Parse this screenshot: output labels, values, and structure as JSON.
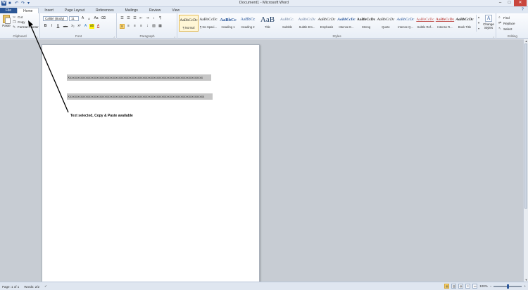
{
  "window": {
    "title": "Document1 - Microsoft Word",
    "app_letter": "W",
    "minimize": "–",
    "maximize": "□",
    "close": "✕"
  },
  "qat": {
    "save": "■",
    "undo": "↶",
    "redo": "↷",
    "more": "▾"
  },
  "tabs": [
    {
      "label": "File"
    },
    {
      "label": "Home"
    },
    {
      "label": "Insert"
    },
    {
      "label": "Page Layout"
    },
    {
      "label": "References"
    },
    {
      "label": "Mailings"
    },
    {
      "label": "Review"
    },
    {
      "label": "View"
    }
  ],
  "help": "?",
  "clipboard": {
    "label": "Clipboard",
    "paste": "Paste",
    "cut": "Cut",
    "copy": "Copy",
    "format_painter": "Format Painter"
  },
  "font": {
    "label": "Font",
    "name": "Calibri (Body)",
    "size": "11",
    "grow": "A",
    "shrink": "A",
    "case": "Aa",
    "clear": "⌫",
    "bold": "B",
    "italic": "I",
    "underline": "U",
    "strike": "abc",
    "subscript": "x₂",
    "superscript": "x²",
    "effects": "A",
    "highlight": "ab",
    "color": "A"
  },
  "paragraph": {
    "label": "Paragraph",
    "bullets": "☰",
    "numbering": "☰",
    "multilevel": "☰",
    "decrease": "⇤",
    "increase": "⇥",
    "sort": "↕",
    "pilcrow": "¶",
    "left": "≡",
    "center": "≡",
    "right": "≡",
    "justify": "≡",
    "spacing": "↕",
    "shading": "▨",
    "borders": "▦"
  },
  "styles": {
    "label": "Styles",
    "items": [
      {
        "sample": "AaBbCcDc",
        "name": "¶ Normal"
      },
      {
        "sample": "AaBbCcDc",
        "name": "¶ No Spaci..."
      },
      {
        "sample": "AaBbCc",
        "name": "Heading 1"
      },
      {
        "sample": "AaBbCc",
        "name": "Heading 2"
      },
      {
        "sample": "AaB",
        "name": "Title"
      },
      {
        "sample": "AaBbCc.",
        "name": "Subtitle"
      },
      {
        "sample": "AaBbCcDc",
        "name": "Subtle Em..."
      },
      {
        "sample": "AaBbCcDc",
        "name": "Emphasis"
      },
      {
        "sample": "AaBbCcDc",
        "name": "Intense E..."
      },
      {
        "sample": "AaBbCcDc",
        "name": "Strong"
      },
      {
        "sample": "AaBbCcDc",
        "name": "Quote"
      },
      {
        "sample": "AaBbCcDc",
        "name": "Intense Q..."
      },
      {
        "sample": "AaBbCcDc",
        "name": "Subtle Ref..."
      },
      {
        "sample": "AaBbCcDc",
        "name": "Intense R..."
      },
      {
        "sample": "AaBbCcDc",
        "name": "Book Title"
      }
    ],
    "change": "Change Styles",
    "change_icon": "A"
  },
  "editing": {
    "label": "Editing",
    "find": "Find",
    "replace": "Replace",
    "select": "Select"
  },
  "document": {
    "line1": "Xxxxxxxxxxxxxxxxxxxxxxxxxxxxxxxxxxxxxxxxxxxxxxxxxxxxxxxxxxxxxxxxxxxxxxxxxxxxxxxxxxxxx",
    "line2": "Xxxxxxxxxxxxxxxxxxxxxxxxxxxxxxxxxxxxxxxxxxxxxxxxxxxxxxxxxxxxxxxxxxxxxxxxxxxxxxxxxxxxxx",
    "annotation": "Text selected, Copy & Paste available"
  },
  "status": {
    "page": "Page: 1 of 1",
    "words": "Words: 2/2",
    "zoom": "100%"
  }
}
